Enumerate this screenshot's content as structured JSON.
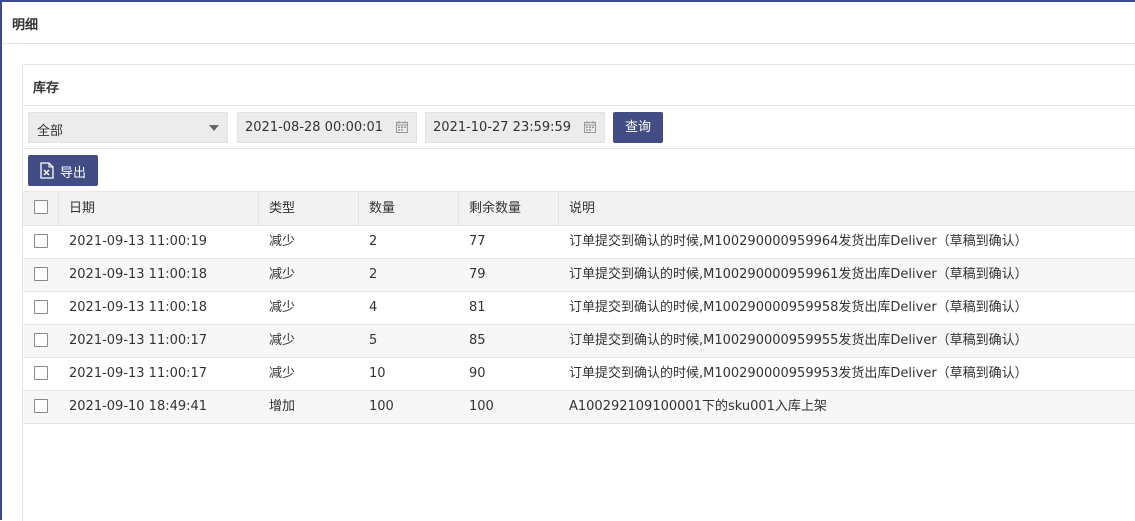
{
  "window": {
    "title": "明细"
  },
  "panel": {
    "title": "库存"
  },
  "filters": {
    "type_select": "全部",
    "start_date": "2021-08-28 00:00:01",
    "end_date": "2021-10-27 23:59:59",
    "query_label": "查询"
  },
  "toolbar": {
    "export_label": "导出"
  },
  "table": {
    "headers": {
      "date": "日期",
      "type": "类型",
      "qty": "数量",
      "remaining": "剩余数量",
      "desc": "说明"
    },
    "rows": [
      {
        "date": "2021-09-13 11:00:19",
        "type": "减少",
        "qty": "2",
        "remaining": "77",
        "desc": "订单提交到确认的时候,M100290000959964发货出库Deliver（草稿到确认）"
      },
      {
        "date": "2021-09-13 11:00:18",
        "type": "减少",
        "qty": "2",
        "remaining": "79",
        "desc": "订单提交到确认的时候,M100290000959961发货出库Deliver（草稿到确认）"
      },
      {
        "date": "2021-09-13 11:00:18",
        "type": "减少",
        "qty": "4",
        "remaining": "81",
        "desc": "订单提交到确认的时候,M100290000959958发货出库Deliver（草稿到确认）"
      },
      {
        "date": "2021-09-13 11:00:17",
        "type": "减少",
        "qty": "5",
        "remaining": "85",
        "desc": "订单提交到确认的时候,M100290000959955发货出库Deliver（草稿到确认）"
      },
      {
        "date": "2021-09-13 11:00:17",
        "type": "减少",
        "qty": "10",
        "remaining": "90",
        "desc": "订单提交到确认的时候,M100290000959953发货出库Deliver（草稿到确认）"
      },
      {
        "date": "2021-09-10 18:49:41",
        "type": "增加",
        "qty": "100",
        "remaining": "100",
        "desc": "A100292109100001下的sku001入库上架"
      }
    ]
  },
  "colors": {
    "accent": "#414d84",
    "border": "#e6e6e6",
    "header_bg": "#f2f2f2"
  }
}
